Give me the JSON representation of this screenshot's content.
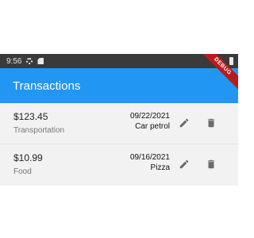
{
  "status_bar": {
    "time": "9:56",
    "icons": [
      "settings-icon",
      "sd-card-icon",
      "battery-icon"
    ]
  },
  "app_bar": {
    "title": "Transactions",
    "color": "#2196f3"
  },
  "debug_banner": "DEBUG",
  "transactions": [
    {
      "amount": "$123.45",
      "category": "Transportation",
      "date": "09/22/2021",
      "description": "Car petrol"
    },
    {
      "amount": "$10.99",
      "category": "Food",
      "date": "09/16/2021",
      "description": "Pizza"
    }
  ],
  "actions": {
    "edit_icon": "pencil-icon",
    "delete_icon": "trash-icon",
    "icon_color": "#6b6b6b"
  }
}
